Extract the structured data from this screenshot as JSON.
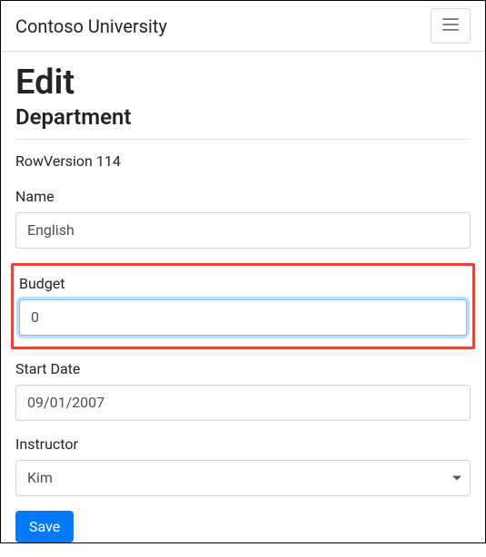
{
  "navbar": {
    "brand": "Contoso University"
  },
  "page": {
    "heading": "Edit",
    "subheading": "Department",
    "rowversion_text": "RowVersion 114"
  },
  "form": {
    "name": {
      "label": "Name",
      "value": "English"
    },
    "budget": {
      "label": "Budget",
      "value": "0"
    },
    "start_date": {
      "label": "Start Date",
      "value": "09/01/2007"
    },
    "instructor": {
      "label": "Instructor",
      "selected": "Kim"
    },
    "save_label": "Save"
  }
}
